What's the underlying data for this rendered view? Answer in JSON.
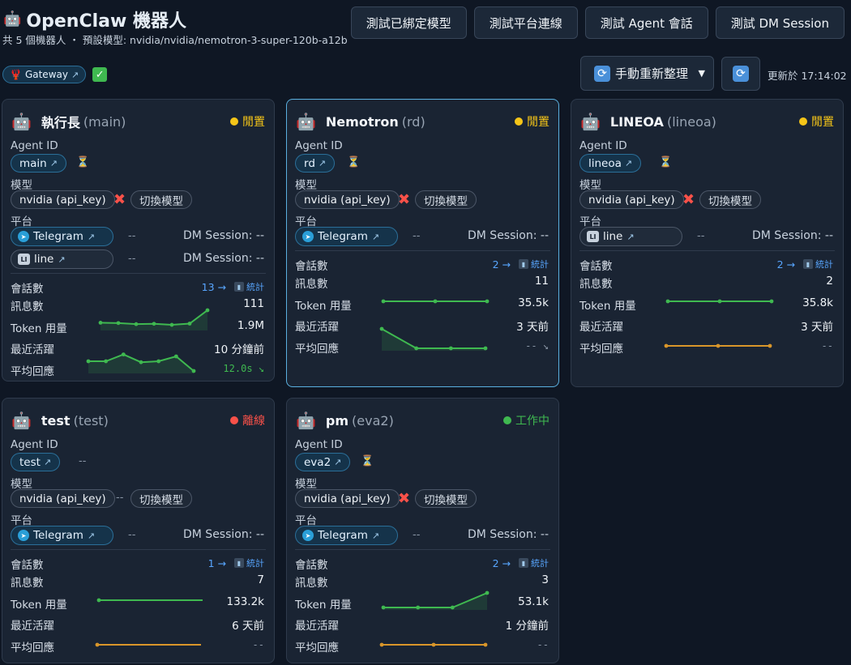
{
  "header": {
    "title": "OpenClaw 機器人",
    "subtitle": "共 5 個機器人 ・ 預設模型: nvidia/nvidia/nemotron-3-super-120b-a12b",
    "buttons": [
      "測試已綁定模型",
      "測試平台連線",
      "測試 Agent 會話",
      "測試 DM Session"
    ],
    "gateway_label": "Gateway",
    "refresh_select": "手動重新整理",
    "updated": "更新於 17:14:02"
  },
  "labels": {
    "agent_id": "Agent ID",
    "model": "模型",
    "platform": "平台",
    "sessions": "會話數",
    "messages": "訊息數",
    "tokens": "Token 用量",
    "last_active": "最近活躍",
    "avg_response": "平均回應",
    "switch_model": "切換模型",
    "stats": "統計",
    "dashes": "--"
  },
  "colors": {
    "idle": "#f5c518",
    "offline": "#f85149",
    "working": "#3fb950",
    "accent": "#58a6ff",
    "spark_green": "#3fb950",
    "spark_orange": "#d9962a"
  },
  "bots": [
    {
      "name": "執行長",
      "id": "main",
      "status": "閒置",
      "status_key": "idle",
      "id_extra": "hourglass",
      "model": "nvidia (api_key)",
      "model_ok": false,
      "platforms": [
        {
          "name": "Telegram",
          "type": "telegram",
          "dashes": "--",
          "dm": "DM Session: --"
        },
        {
          "name": "line",
          "type": "line",
          "dashes": "--",
          "dm": "DM Session: --"
        }
      ],
      "sessions": "13 →",
      "messages": "111",
      "tokens": "1.9M",
      "last_active": "10 分鐘前",
      "avg_response": "12.0s ↘",
      "token_series": [
        0.3,
        0.28,
        0.22,
        0.24,
        0.18,
        0.25,
        1.0
      ],
      "response_series": [
        0.5,
        0.5,
        0.85,
        0.45,
        0.5,
        0.75,
        0.0
      ]
    },
    {
      "name": "Nemotron",
      "id": "rd",
      "status": "閒置",
      "status_key": "idle",
      "id_extra": "hourglass",
      "model": "nvidia (api_key)",
      "model_ok": false,
      "platforms": [
        {
          "name": "Telegram",
          "type": "telegram",
          "dashes": "--",
          "dm": "DM Session: --"
        }
      ],
      "sessions": "2 →",
      "messages": "11",
      "tokens": "35.5k",
      "last_active": "3 天前",
      "avg_response": "-- ↘",
      "token_series": [
        0.5,
        0.5,
        0.5
      ],
      "response_series": [
        1.0,
        0.0,
        0.0,
        0.0
      ]
    },
    {
      "name": "LINEOA",
      "id": "lineoa",
      "status": "閒置",
      "status_key": "idle",
      "id_extra": "hourglass",
      "model": "nvidia (api_key)",
      "model_ok": false,
      "platforms": [
        {
          "name": "line",
          "type": "line",
          "dashes": "--",
          "dm": "DM Session: --"
        }
      ],
      "sessions": "2 →",
      "messages": "2",
      "tokens": "35.8k",
      "last_active": "3 天前",
      "avg_response": "--",
      "token_series": [
        0.5,
        0.5,
        0.5
      ],
      "response_series": [
        0.5,
        0.5,
        0.5
      ]
    },
    {
      "name": "test",
      "id": "test",
      "status": "離線",
      "status_key": "offline",
      "id_extra": "--",
      "model": "nvidia (api_key)",
      "model_ok": null,
      "platforms": [
        {
          "name": "Telegram",
          "type": "telegram",
          "dashes": "--",
          "dm": "DM Session: --"
        }
      ],
      "sessions": "1 →",
      "messages": "7",
      "tokens": "133.2k",
      "last_active": "6 天前",
      "avg_response": "--",
      "token_series": [
        0.5,
        0.5
      ],
      "response_series": [
        0.5,
        0.5
      ]
    },
    {
      "name": "pm",
      "id": "eva2",
      "status": "工作中",
      "status_key": "working",
      "id_extra": "hourglass",
      "model": "nvidia (api_key)",
      "model_ok": false,
      "platforms": [
        {
          "name": "Telegram",
          "type": "telegram",
          "dashes": "--",
          "dm": "DM Session: --"
        }
      ],
      "sessions": "2 →",
      "messages": "3",
      "tokens": "53.1k",
      "last_active": "1 分鐘前",
      "avg_response": "--",
      "token_series": [
        0.0,
        0.0,
        0.0,
        1.0
      ],
      "response_series": [
        0.5,
        0.5,
        0.5
      ]
    }
  ]
}
